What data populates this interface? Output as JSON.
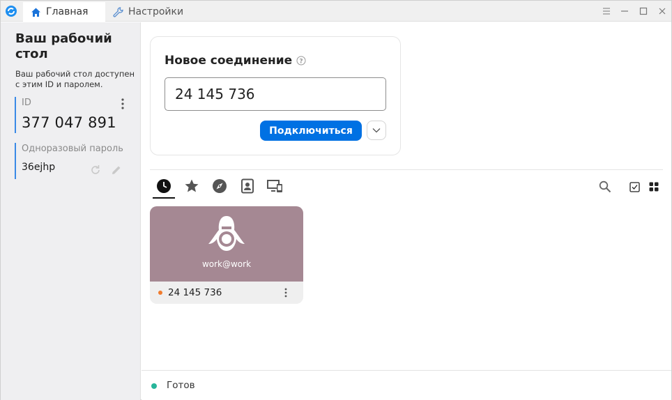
{
  "tabs": [
    {
      "label": "Главная",
      "icon": "home-icon"
    },
    {
      "label": "Настройки",
      "icon": "wrench-icon"
    }
  ],
  "window_controls": [
    "menu-icon",
    "minimize-icon",
    "maximize-icon",
    "close-icon"
  ],
  "left_panel": {
    "title": "Ваш рабочий стол",
    "description": "Ваш рабочий стол доступен с этим ID и паролем.",
    "id_label": "ID",
    "id_value": "377 047 891",
    "password_label": "Одноразовый пароль",
    "password_value": "36ejhp"
  },
  "new_connection": {
    "title": "Новое соединение",
    "input_value": "24 145 736",
    "connect_label": "Подключиться"
  },
  "peer_tabs": [
    "recent-icon",
    "favorites-icon",
    "discovered-icon",
    "address-book-icon",
    "group-icon"
  ],
  "peers": [
    {
      "alias": "work@work",
      "id": "24 145 736",
      "status_color": "#f07b2d"
    }
  ],
  "status": {
    "text": "Готов",
    "color": "#27b59a"
  },
  "colors": {
    "accent": "#0071e3",
    "id_bar": "#3a8ae6",
    "peer_bg": "#a58893"
  }
}
